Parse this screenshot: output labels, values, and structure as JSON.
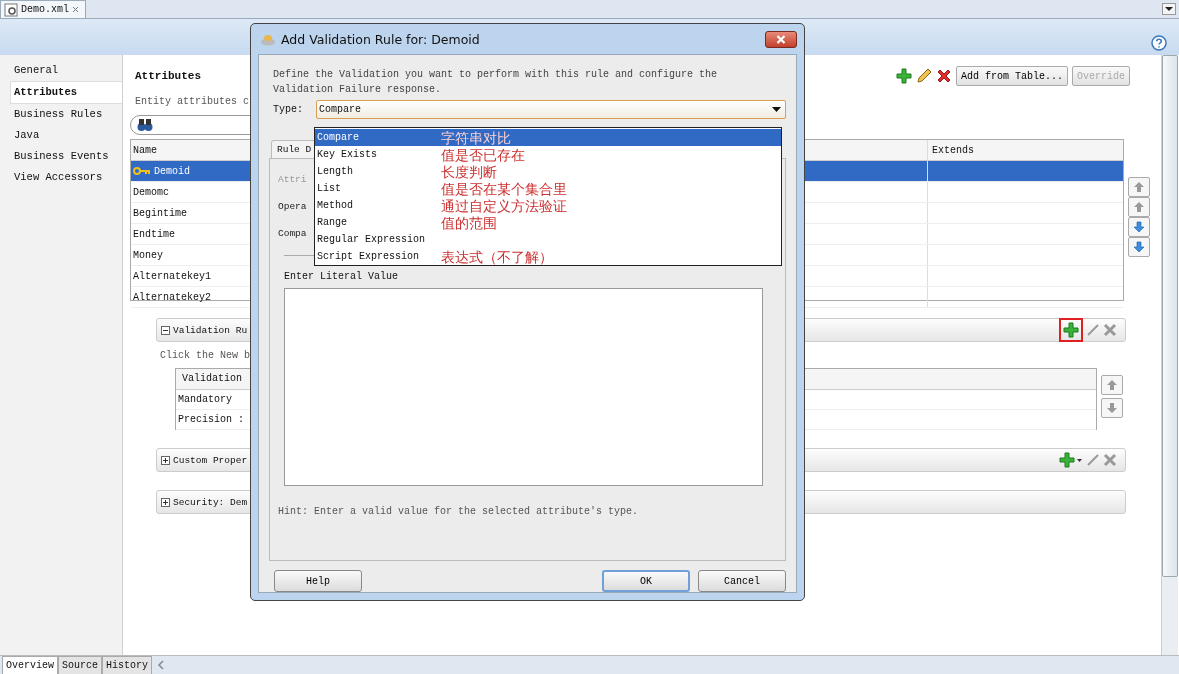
{
  "editor_tab": {
    "title": "Demo.xml"
  },
  "nav": [
    {
      "label": "General",
      "selected": false
    },
    {
      "label": "Attributes",
      "selected": true
    },
    {
      "label": "Business Rules",
      "selected": false
    },
    {
      "label": "Java",
      "selected": false
    },
    {
      "label": "Business Events",
      "selected": false
    },
    {
      "label": "View Accessors",
      "selected": false
    }
  ],
  "attributes": {
    "title": "Attributes",
    "description": "Entity attributes c",
    "buttons": [
      {
        "label": "Add from Table...",
        "disabled": false
      },
      {
        "label": "Override",
        "disabled": true
      }
    ],
    "columns": [
      "Name",
      "Extends"
    ],
    "rows": [
      {
        "name": "Demoid",
        "key": true,
        "selected": true
      },
      {
        "name": "Demomc",
        "key": false,
        "selected": false
      },
      {
        "name": "Begintime",
        "key": false,
        "selected": false
      },
      {
        "name": "Endtime",
        "key": false,
        "selected": false
      },
      {
        "name": "Money",
        "key": false,
        "selected": false
      },
      {
        "name": "Alternatekey1",
        "key": false,
        "selected": false
      },
      {
        "name": "Alternatekey2",
        "key": false,
        "selected": false
      }
    ]
  },
  "validation": {
    "title": "Validation Ru",
    "expanded": true,
    "add_highlighted": true,
    "hint": "Click the New b",
    "column": "Validation ",
    "rows": [
      "Mandatory",
      "Precision :"
    ]
  },
  "sections": [
    {
      "title": "Custom Proper",
      "expanded": false,
      "add_menu": true
    },
    {
      "title": "Security: Dem",
      "expanded": false,
      "add_menu": false
    }
  ],
  "bottom_tabs": [
    {
      "label": "Overview",
      "selected": true
    },
    {
      "label": "Source",
      "selected": false
    },
    {
      "label": "History",
      "selected": false
    }
  ],
  "dialog": {
    "title": "Add Validation Rule for: Demoid",
    "description": "Define the Validation you want to perform with this rule and configure the Validation Failure response.",
    "type_label": "Type:",
    "type_value": "Compare",
    "options": [
      {
        "label": "Compare",
        "selected": true,
        "note": "字符串对比"
      },
      {
        "label": "Key Exists",
        "selected": false,
        "note": "值是否已存在"
      },
      {
        "label": "Length",
        "selected": false,
        "note": "长度判断"
      },
      {
        "label": "List",
        "selected": false,
        "note": "值是否在某个集合里"
      },
      {
        "label": "Method",
        "selected": false,
        "note": "通过自定义方法验证"
      },
      {
        "label": "Range",
        "selected": false,
        "note": "值的范围"
      },
      {
        "label": "Regular Expression",
        "selected": false
      },
      {
        "label": "Script Expression",
        "selected": false,
        "note": "表达式（不了解）"
      }
    ],
    "tab": "Rule D",
    "fields": [
      {
        "label": "Attri",
        "disabled": true
      },
      {
        "label": "Opera",
        "disabled": false
      },
      {
        "label": "Compa",
        "disabled": false
      }
    ],
    "literal_label": "Enter Literal Value",
    "hint": "Hint: Enter a valid value for the selected attribute's type.",
    "buttons": [
      {
        "label": "Help",
        "kind": "help"
      },
      {
        "label": "OK",
        "kind": "default"
      },
      {
        "label": "Cancel",
        "kind": "cancel"
      }
    ]
  }
}
